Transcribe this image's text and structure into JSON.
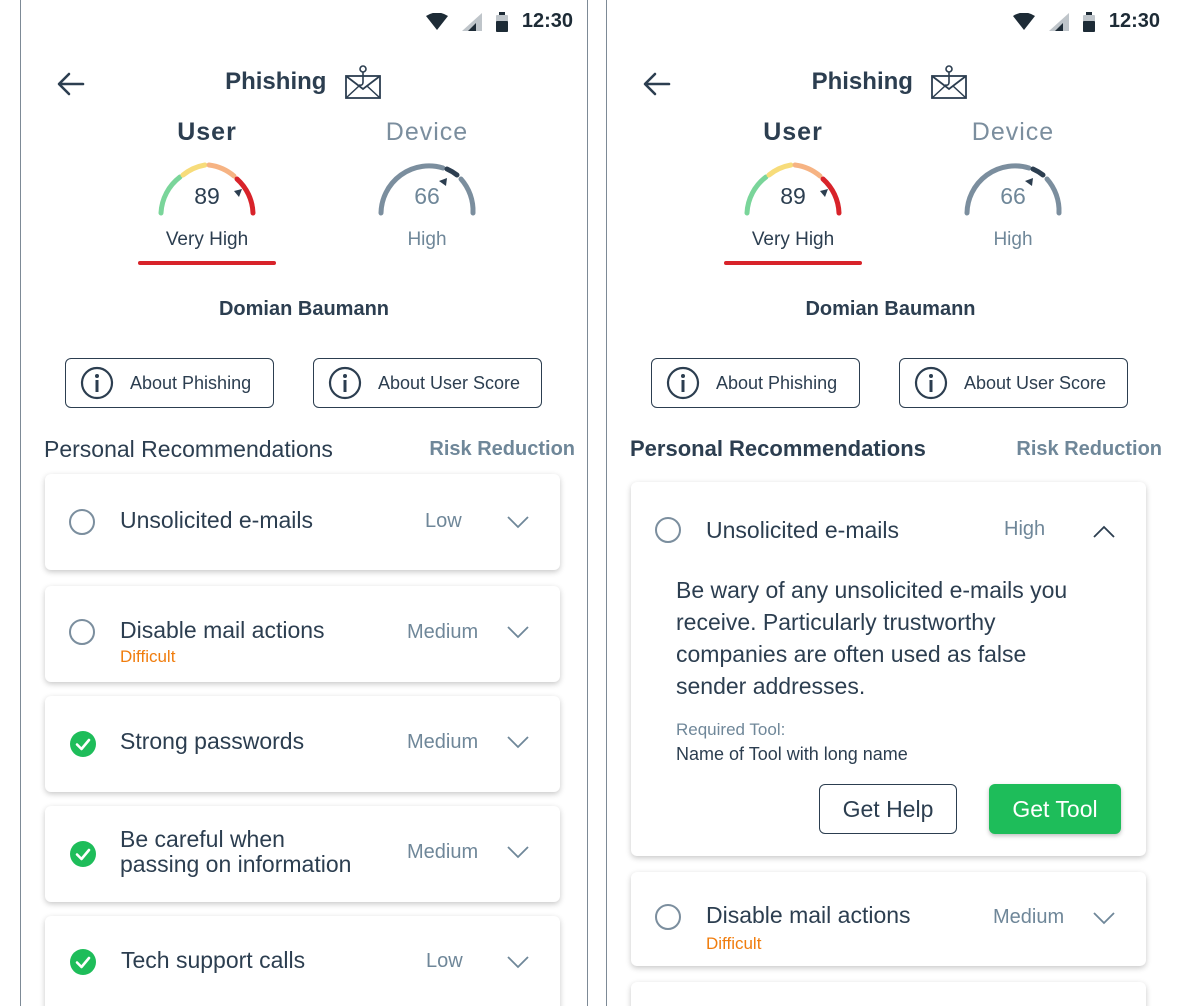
{
  "status": {
    "time": "12:30"
  },
  "header": {
    "title": "Phishing"
  },
  "scores": {
    "user": {
      "tab": "User",
      "value": "89",
      "level": "Very High"
    },
    "device": {
      "tab": "Device",
      "value": "66",
      "level": "High"
    }
  },
  "user_name": "Domian Baumann",
  "buttons": {
    "about_phishing": "About Phishing",
    "about_score": "About User Score"
  },
  "section": {
    "title": "Personal Recommendations",
    "subtitle": "Risk Reduction"
  },
  "left_recommendations": [
    {
      "name": "Unsolicited e-mails",
      "sub": "",
      "risk": "Low",
      "done": false
    },
    {
      "name": "Disable mail actions",
      "sub": "Difficult",
      "risk": "Medium",
      "done": false
    },
    {
      "name": "Strong passwords",
      "sub": "",
      "risk": "Medium",
      "done": true
    },
    {
      "name_line1": "Be careful when",
      "name_line2": "passing on information",
      "risk": "Medium",
      "done": true
    },
    {
      "name": "Tech support calls",
      "sub": "",
      "risk": "Low",
      "done": true
    }
  ],
  "right_recommendations": {
    "expanded": {
      "name": "Unsolicited e-mails",
      "risk": "High",
      "description_lines": [
        "Be wary of any unsolicited e-mails you",
        "receive. Particularly trustworthy",
        "companies are often used as false",
        "sender addresses."
      ],
      "tool_label": "Required Tool:",
      "tool_name": "Name of Tool with long name",
      "help_label": "Get Help",
      "tool_button_label": "Get Tool"
    },
    "next": {
      "name": "Disable mail actions",
      "sub": "Difficult",
      "risk": "Medium"
    }
  },
  "colors": {
    "text": "#2c3e50",
    "muted": "#6f8799",
    "accent_red": "#d8232a",
    "green": "#1ebd5a",
    "orange": "#f07d0e"
  }
}
